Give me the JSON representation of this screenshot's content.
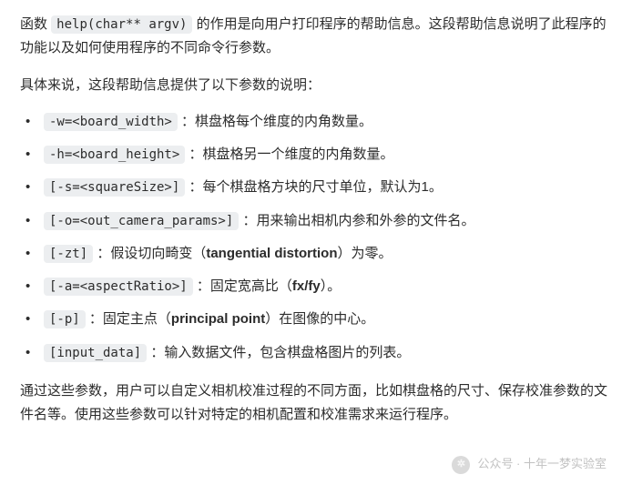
{
  "intro": {
    "prefix": "函数 ",
    "code": "help(char** argv)",
    "suffix": " 的作用是向用户打印程序的帮助信息。这段帮助信息说明了此程序的功能以及如何使用程序的不同命令行参数。"
  },
  "lead": "具体来说，这段帮助信息提供了以下参数的说明：",
  "items": [
    {
      "code": "-w=<board_width>",
      "desc": "：棋盘格每个维度的内角数量。"
    },
    {
      "code": "-h=<board_height>",
      "desc": "：棋盘格另一个维度的内角数量。"
    },
    {
      "code": "[-s=<squareSize>]",
      "desc": "：每个棋盘格方块的尺寸单位，默认为1。"
    },
    {
      "code": "[-o=<out_camera_params>]",
      "desc": "：用来输出相机内参和外参的文件名。"
    },
    {
      "code": "[-zt]",
      "desc_before": "：假设切向畸变（",
      "bold": "tangential distortion",
      "desc_after": "）为零。"
    },
    {
      "code": "[-a=<aspectRatio>]",
      "desc_before": "：固定宽高比（",
      "bold": "fx/fy",
      "desc_after": "）。"
    },
    {
      "code": "[-p]",
      "desc_before": "：固定主点（",
      "bold": "principal point",
      "desc_after": "）在图像的中心。"
    },
    {
      "code": "[input_data]",
      "desc": "：输入数据文件，包含棋盘格图片的列表。"
    }
  ],
  "outro": "通过这些参数，用户可以自定义相机校准过程的不同方面，比如棋盘格的尺寸、保存校准参数的文件名等。使用这些参数可以针对特定的相机配置和校准需求来运行程序。",
  "watermark": {
    "label": "公众号 · 十年一梦实验室"
  }
}
